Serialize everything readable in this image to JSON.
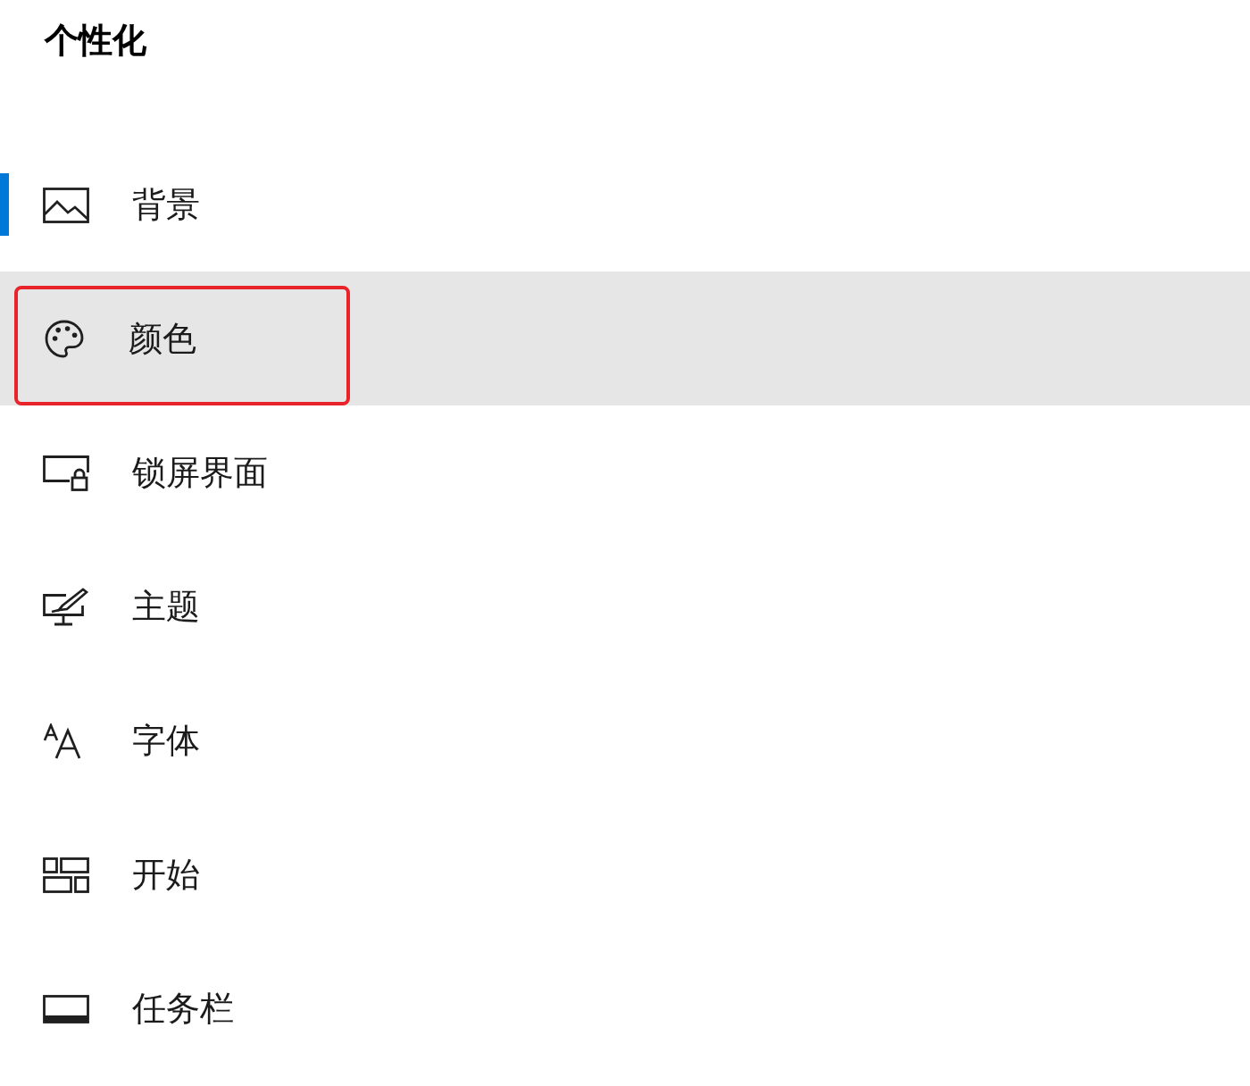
{
  "title": "个性化",
  "items": [
    {
      "label": "背景",
      "selected": true,
      "hovered": false,
      "highlighted": false
    },
    {
      "label": "颜色",
      "selected": false,
      "hovered": true,
      "highlighted": true
    },
    {
      "label": "锁屏界面",
      "selected": false,
      "hovered": false,
      "highlighted": false
    },
    {
      "label": "主题",
      "selected": false,
      "hovered": false,
      "highlighted": false
    },
    {
      "label": "字体",
      "selected": false,
      "hovered": false,
      "highlighted": false
    },
    {
      "label": "开始",
      "selected": false,
      "hovered": false,
      "highlighted": false
    },
    {
      "label": "任务栏",
      "selected": false,
      "hovered": false,
      "highlighted": false
    }
  ]
}
